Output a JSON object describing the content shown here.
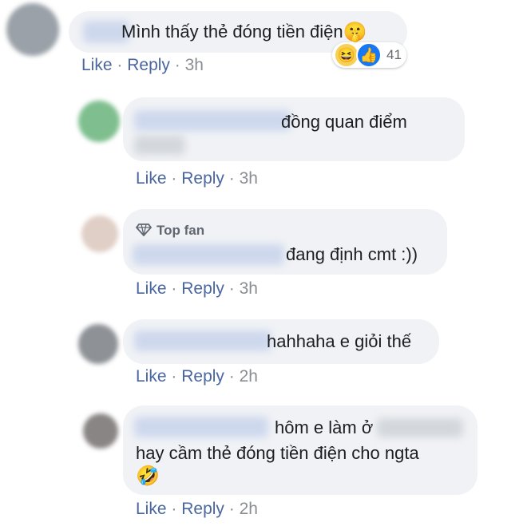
{
  "comments": [
    {
      "text": "Mình thấy thẻ đóng tiền điện",
      "emoji": "🤫",
      "reactions": {
        "icons": [
          "😆",
          "👍"
        ],
        "count": "41"
      },
      "actions": {
        "like": "Like",
        "reply": "Reply",
        "time": "3h"
      }
    },
    {
      "text": "đồng quan điểm",
      "actions": {
        "like": "Like",
        "reply": "Reply",
        "time": "3h"
      }
    },
    {
      "badge": "Top fan",
      "text": "đang định cmt :))",
      "actions": {
        "like": "Like",
        "reply": "Reply",
        "time": "3h"
      }
    },
    {
      "text": "hahhaha e giỏi thế",
      "actions": {
        "like": "Like",
        "reply": "Reply",
        "time": "2h"
      }
    },
    {
      "text_line1": "hôm e làm ở",
      "text_line2": "hay cầm thẻ đóng tiền điện cho ngta",
      "emoji": "🤣",
      "actions": {
        "like": "Like",
        "reply": "Reply",
        "time": "2h"
      }
    }
  ],
  "separator": "·",
  "colors": {
    "link": "#365899",
    "bubble": "#f0f2f5",
    "meta": "#8a8d91"
  }
}
